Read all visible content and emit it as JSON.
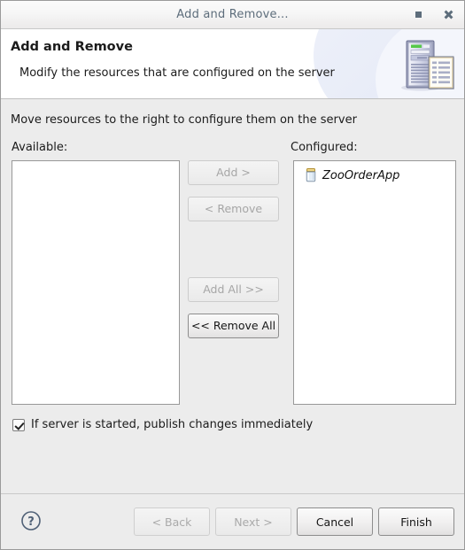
{
  "window": {
    "title": "Add and Remove...",
    "controls": [
      {
        "name": "maximize-button",
        "icon": "maximize-icon"
      },
      {
        "name": "close-button",
        "icon": "close-icon"
      }
    ]
  },
  "header": {
    "title": "Add and Remove",
    "subtitle": "Modify the resources that are configured on the server",
    "icon": "server-and-document-icon"
  },
  "main": {
    "instruction": "Move resources to the right to configure them on the server",
    "available": {
      "label": "Available:",
      "items": []
    },
    "configured": {
      "label": "Configured:",
      "items": [
        {
          "label": "ZooOrderApp",
          "icon": "jar-icon"
        }
      ]
    },
    "transfer_buttons": [
      {
        "label": "Add >",
        "enabled": false
      },
      {
        "label": "< Remove",
        "enabled": false
      },
      {
        "label": "Add All >>",
        "enabled": false
      },
      {
        "label": "<< Remove All",
        "enabled": true
      }
    ],
    "publish_checkbox": {
      "label": "If server is started, publish changes immediately",
      "checked": true
    }
  },
  "footer": {
    "help_icon": "help-icon",
    "buttons": [
      {
        "label": "< Back",
        "enabled": false
      },
      {
        "label": "Next >",
        "enabled": false
      },
      {
        "label": "Cancel",
        "enabled": true
      },
      {
        "label": "Finish",
        "enabled": true
      }
    ]
  },
  "colors": {
    "dialog_background": "#ececec",
    "header_background": "#ffffff",
    "title_text": "#5d6d7b",
    "list_background": "#ffffff",
    "jar_lid": "#e8c96a",
    "server_led": "#57c94a"
  }
}
